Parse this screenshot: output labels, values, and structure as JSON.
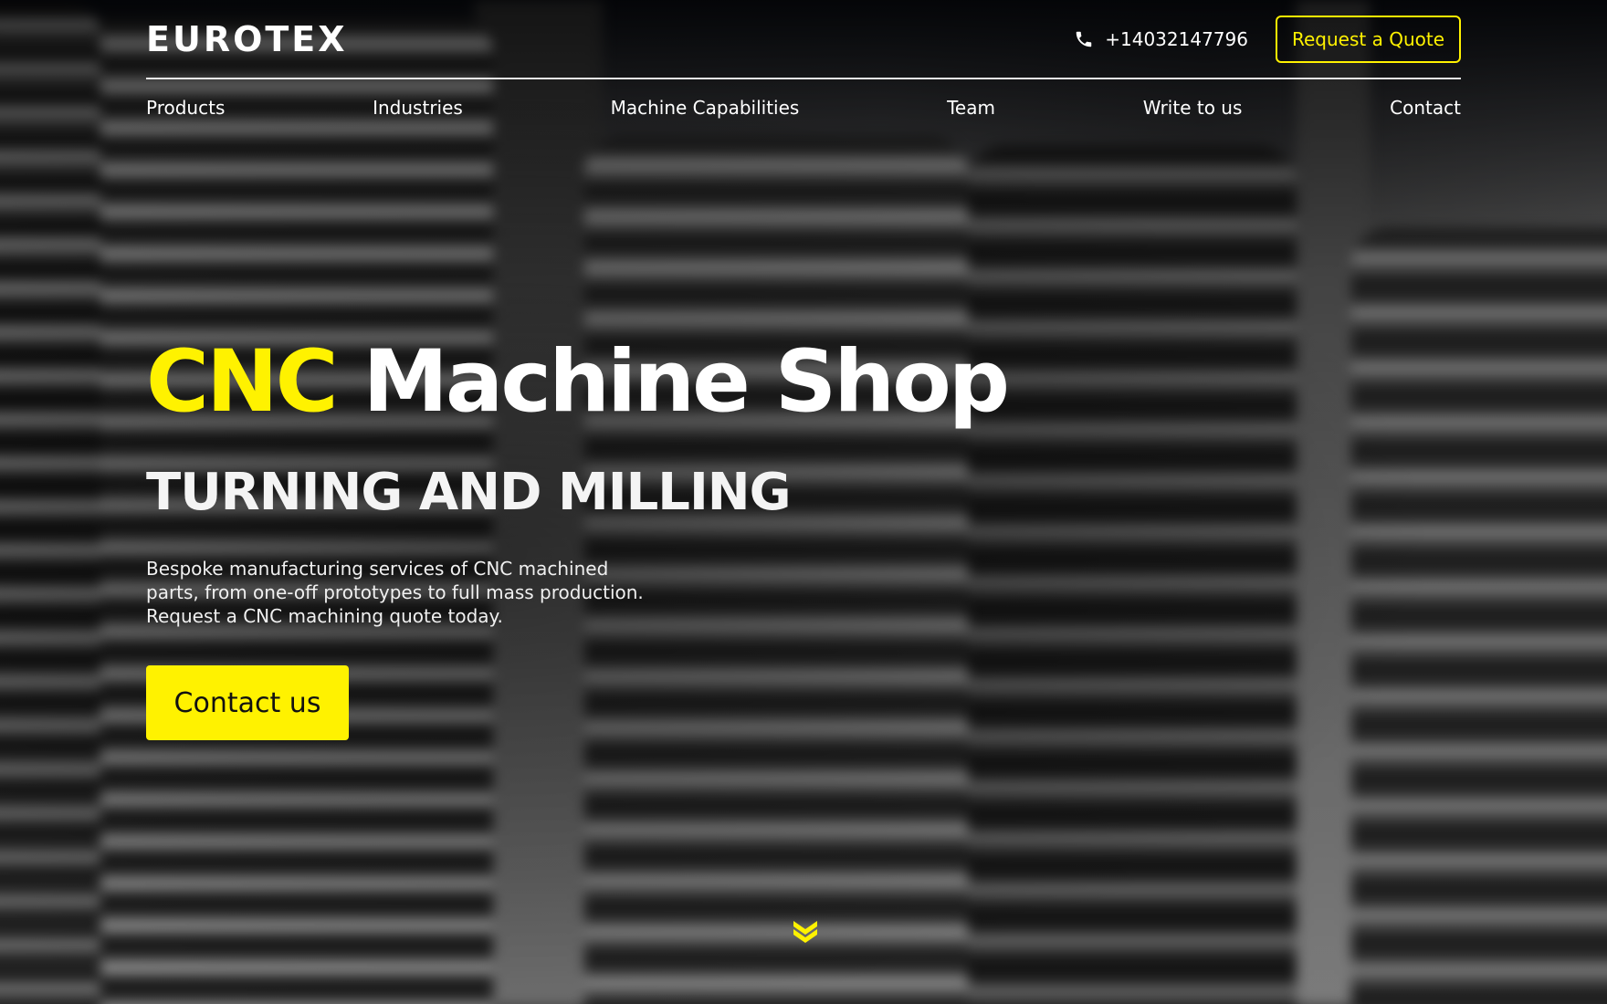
{
  "header": {
    "logo": "EUROTEX",
    "phone": "+14032147796",
    "quote_label": "Request a Quote"
  },
  "nav": {
    "items": [
      {
        "label": "Products"
      },
      {
        "label": "Industries"
      },
      {
        "label": "Machine Capabilities"
      },
      {
        "label": "Team"
      },
      {
        "label": "Write to us"
      },
      {
        "label": "Contact"
      }
    ]
  },
  "hero": {
    "headline_accent": "CNC",
    "headline_rest": "Machine Shop",
    "subheadline": "TURNING AND MILLING",
    "description_lines": [
      "Bespoke manufacturing services of CNC machined",
      "parts, from one-off prototypes to full mass production.",
      "Request a CNC machining quote today."
    ],
    "cta_label": "Contact us"
  },
  "icons": {
    "phone": "phone-icon",
    "scroll": "chevron-double-down-icon"
  },
  "colors": {
    "accent": "#fff200",
    "text": "#ffffff",
    "cta_text": "#111111"
  }
}
